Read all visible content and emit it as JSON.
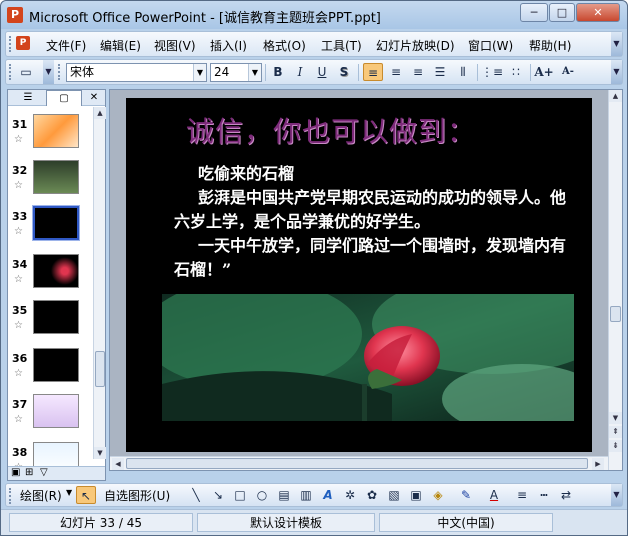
{
  "window": {
    "title": "Microsoft Office PowerPoint - [诚信教育主题班会PPT.ppt]",
    "controls": {
      "minimize": "─",
      "maximize": "□",
      "close": "✕"
    }
  },
  "menu": {
    "items": [
      {
        "label": "文件(F)"
      },
      {
        "label": "编辑(E)"
      },
      {
        "label": "视图(V)"
      },
      {
        "label": "插入(I)"
      },
      {
        "label": "格式(O)"
      },
      {
        "label": "工具(T)"
      },
      {
        "label": "幻灯片放映(D)"
      },
      {
        "label": "窗口(W)"
      },
      {
        "label": "帮助(H)"
      }
    ]
  },
  "toolbar": {
    "font": "宋体",
    "size": "24",
    "bold": "B",
    "italic": "I",
    "underline": "U",
    "shadow": "S",
    "grow_font": "A+",
    "shrink_font": "A-"
  },
  "slides": {
    "tabs": {
      "outline": "outline-icon",
      "slides": "slides-icon",
      "close": "✕"
    },
    "list": [
      {
        "num": "31",
        "icon": "slide-thumb-31"
      },
      {
        "num": "32",
        "icon": "slide-thumb-32"
      },
      {
        "num": "33",
        "icon": "slide-thumb-33",
        "selected": true
      },
      {
        "num": "34",
        "icon": "slide-thumb-34"
      },
      {
        "num": "35",
        "icon": "slide-thumb-35"
      },
      {
        "num": "36",
        "icon": "slide-thumb-36"
      },
      {
        "num": "37",
        "icon": "slide-thumb-37"
      },
      {
        "num": "38",
        "icon": "slide-thumb-38"
      }
    ],
    "star": "☆"
  },
  "slide": {
    "title": "诚信，你也可以做到：",
    "heading": "吃偷来的石榴",
    "para1": "彭湃是中国共产党早期农民运动的成功的领导人。他六岁上学，是个品学兼优的好学生。",
    "para2": "一天中午放学，同学们路过一个围墙时，发现墙内有石榴！”"
  },
  "drawing": {
    "draw_label": "绘图(R)",
    "autoshape_label": "自选图形(U)"
  },
  "status": {
    "slide_pos": "幻灯片 33 / 45",
    "template": "默认设计模板",
    "language": "中文(中国)"
  },
  "colors": {
    "title_purple": "#7d2b7a",
    "slide_bg": "#000000",
    "selection": "#2f58c4"
  }
}
